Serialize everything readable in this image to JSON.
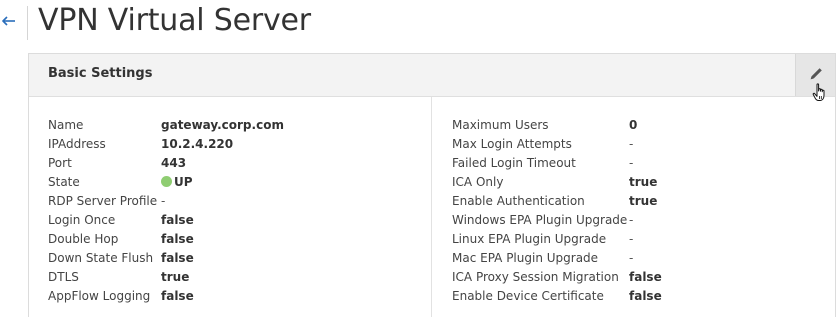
{
  "page": {
    "title": "VPN Virtual Server"
  },
  "panel": {
    "title": "Basic Settings",
    "edit_icon": "pencil-icon"
  },
  "colors": {
    "link_blue": "#2a6ebb",
    "status_up_green": "#8fcd72",
    "header_bg": "#f3f3f3"
  },
  "left_properties": [
    {
      "label": "Name",
      "value": "gateway.corp.com"
    },
    {
      "label": "IPAddress",
      "value": "10.2.4.220"
    },
    {
      "label": "Port",
      "value": "443"
    },
    {
      "label": "State",
      "value": "UP",
      "status": "up"
    },
    {
      "label": "RDP Server Profile",
      "value": "-"
    },
    {
      "label": "Login Once",
      "value": "false"
    },
    {
      "label": "Double Hop",
      "value": "false"
    },
    {
      "label": "Down State Flush",
      "value": "false"
    },
    {
      "label": "DTLS",
      "value": "true"
    },
    {
      "label": "AppFlow Logging",
      "value": "false"
    }
  ],
  "right_properties": [
    {
      "label": "Maximum Users",
      "value": "0"
    },
    {
      "label": "Max Login Attempts",
      "value": "-"
    },
    {
      "label": "Failed Login Timeout",
      "value": "-"
    },
    {
      "label": "ICA Only",
      "value": "true"
    },
    {
      "label": "Enable Authentication",
      "value": "true"
    },
    {
      "label": "Windows EPA Plugin Upgrade",
      "value": "-"
    },
    {
      "label": "Linux EPA Plugin Upgrade",
      "value": "-"
    },
    {
      "label": "Mac EPA Plugin Upgrade",
      "value": "-"
    },
    {
      "label": "ICA Proxy Session Migration",
      "value": "false"
    },
    {
      "label": "Enable Device Certificate",
      "value": "false"
    }
  ]
}
